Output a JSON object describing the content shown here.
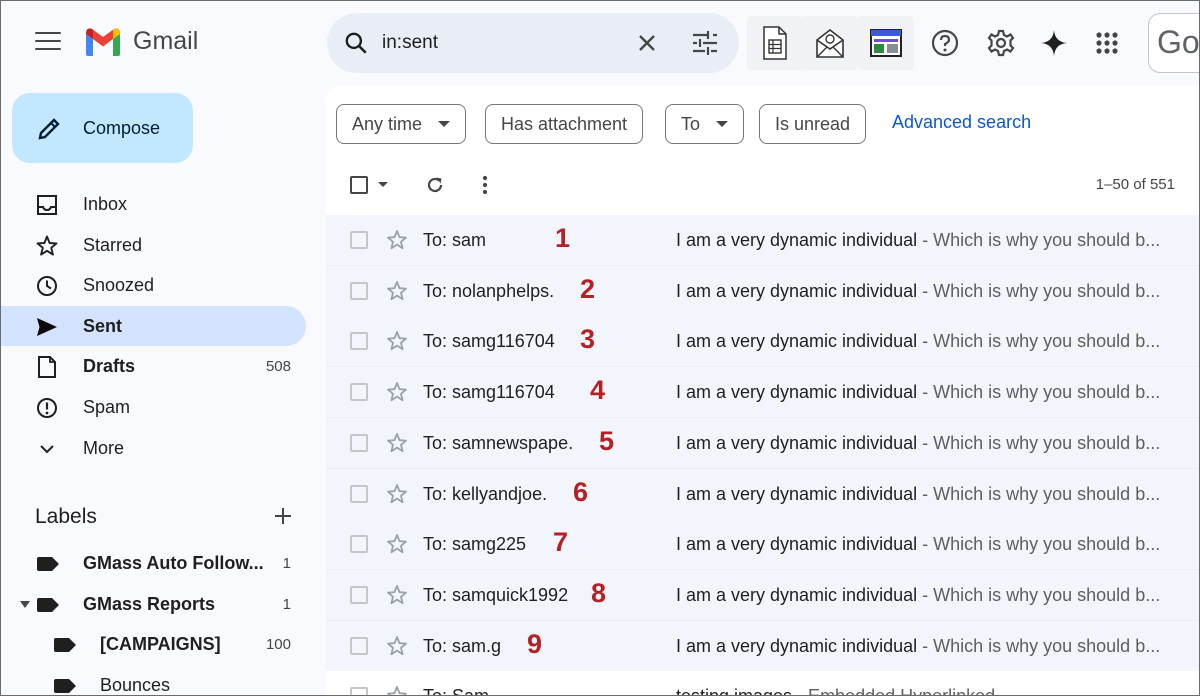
{
  "app": {
    "name": "Gmail",
    "brand_colors": {
      "red": "#ea4335",
      "blue": "#4285f4",
      "green": "#34a853",
      "yellow": "#fbbc04"
    }
  },
  "search": {
    "value": "in:sent"
  },
  "header_icons": [
    "spreadsheet-icon",
    "mail-merge-icon",
    "dashboard-icon",
    "help-icon",
    "settings-icon",
    "gemini-icon",
    "apps-grid-icon"
  ],
  "google_account_text": "Go",
  "compose": {
    "label": "Compose"
  },
  "nav": [
    {
      "label": "Inbox",
      "icon": "inbox-icon",
      "count": "",
      "bold": false,
      "active": false
    },
    {
      "label": "Starred",
      "icon": "star-icon",
      "count": "",
      "bold": false,
      "active": false
    },
    {
      "label": "Snoozed",
      "icon": "clock-icon",
      "count": "",
      "bold": false,
      "active": false
    },
    {
      "label": "Sent",
      "icon": "send-icon",
      "count": "",
      "bold": true,
      "active": true
    },
    {
      "label": "Drafts",
      "icon": "draft-icon",
      "count": "508",
      "bold": true,
      "active": false
    },
    {
      "label": "Spam",
      "icon": "spam-icon",
      "count": "",
      "bold": false,
      "active": false
    },
    {
      "label": "More",
      "icon": "chevron-down-icon",
      "count": "",
      "bold": false,
      "active": false
    }
  ],
  "labels": {
    "title": "Labels",
    "items": [
      {
        "label": "GMass Auto Follow...",
        "count": "1",
        "bold": true,
        "level": 0,
        "expanded": false
      },
      {
        "label": "GMass Reports",
        "count": "1",
        "bold": true,
        "level": 0,
        "expanded": true
      },
      {
        "label": "[CAMPAIGNS]",
        "count": "100",
        "bold": true,
        "level": 1,
        "expanded": false
      },
      {
        "label": "Bounces",
        "count": "",
        "bold": false,
        "level": 1,
        "expanded": false
      }
    ]
  },
  "filters": [
    {
      "label": "Any time",
      "dropdown": true
    },
    {
      "label": "Has attachment",
      "dropdown": false
    },
    {
      "label": "To",
      "dropdown": true
    },
    {
      "label": "Is unread",
      "dropdown": false
    }
  ],
  "advanced_search": "Advanced search",
  "pagination": "1–50 of 551",
  "emails": [
    {
      "to": "To: sam",
      "annotation": "1",
      "subject": "I am a very dynamic individual",
      "snippet": " - Which is why you should b..."
    },
    {
      "to": "To: nolanphelps.",
      "annotation": "2",
      "subject": "I am a very dynamic individual",
      "snippet": " - Which is why you should b..."
    },
    {
      "to": "To: samg116704",
      "annotation": "3",
      "subject": "I am a very dynamic individual",
      "snippet": " - Which is why you should b..."
    },
    {
      "to": "To: samg116704",
      "annotation": "4",
      "subject": "I am a very dynamic individual",
      "snippet": " - Which is why you should b..."
    },
    {
      "to": "To: samnewspape.",
      "annotation": "5",
      "subject": "I am a very dynamic individual",
      "snippet": " - Which is why you should b..."
    },
    {
      "to": "To: kellyandjoe.",
      "annotation": "6",
      "subject": "I am a very dynamic individual",
      "snippet": " - Which is why you should b..."
    },
    {
      "to": "To: samg225",
      "annotation": "7",
      "subject": "I am a very dynamic individual",
      "snippet": " - Which is why you should b..."
    },
    {
      "to": "To: samquick1992",
      "annotation": "8",
      "subject": "I am a very dynamic individual",
      "snippet": " - Which is why you should b..."
    },
    {
      "to": "To: sam.g",
      "annotation": "9",
      "subject": "I am a very dynamic individual",
      "snippet": " - Which is why you should b..."
    },
    {
      "to": "To: Sam",
      "annotation": "",
      "subject": "testing images",
      "snippet": " - Embedded Hyperlinked"
    }
  ]
}
